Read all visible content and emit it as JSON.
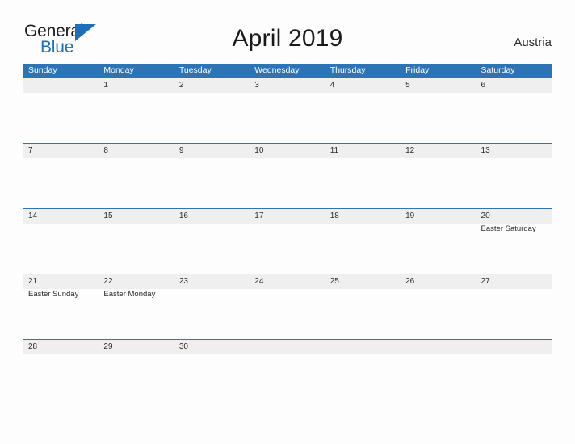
{
  "logo": {
    "word_top": "General",
    "word_bottom": "Blue",
    "triangle_icon": "triangle-flag-icon",
    "accent_color": "#1f6fb8"
  },
  "header": {
    "title": "April 2019",
    "region": "Austria"
  },
  "theme": {
    "header_blue": "#2e74b5",
    "row_band_gray": "#efefef",
    "page_background": "#fdfdfd",
    "text_color": "#2b2b2b"
  },
  "calendar": {
    "month": "April",
    "year": "2019",
    "weekday_headers": [
      "Sunday",
      "Monday",
      "Tuesday",
      "Wednesday",
      "Thursday",
      "Friday",
      "Saturday"
    ],
    "weeks": [
      [
        {
          "day": "",
          "event": ""
        },
        {
          "day": "1",
          "event": ""
        },
        {
          "day": "2",
          "event": ""
        },
        {
          "day": "3",
          "event": ""
        },
        {
          "day": "4",
          "event": ""
        },
        {
          "day": "5",
          "event": ""
        },
        {
          "day": "6",
          "event": ""
        }
      ],
      [
        {
          "day": "7",
          "event": ""
        },
        {
          "day": "8",
          "event": ""
        },
        {
          "day": "9",
          "event": ""
        },
        {
          "day": "10",
          "event": ""
        },
        {
          "day": "11",
          "event": ""
        },
        {
          "day": "12",
          "event": ""
        },
        {
          "day": "13",
          "event": ""
        }
      ],
      [
        {
          "day": "14",
          "event": ""
        },
        {
          "day": "15",
          "event": ""
        },
        {
          "day": "16",
          "event": ""
        },
        {
          "day": "17",
          "event": ""
        },
        {
          "day": "18",
          "event": ""
        },
        {
          "day": "19",
          "event": ""
        },
        {
          "day": "20",
          "event": "Easter Saturday"
        }
      ],
      [
        {
          "day": "21",
          "event": "Easter Sunday"
        },
        {
          "day": "22",
          "event": "Easter Monday"
        },
        {
          "day": "23",
          "event": ""
        },
        {
          "day": "24",
          "event": ""
        },
        {
          "day": "25",
          "event": ""
        },
        {
          "day": "26",
          "event": ""
        },
        {
          "day": "27",
          "event": ""
        }
      ],
      [
        {
          "day": "28",
          "event": ""
        },
        {
          "day": "29",
          "event": ""
        },
        {
          "day": "30",
          "event": ""
        },
        {
          "day": "",
          "event": ""
        },
        {
          "day": "",
          "event": ""
        },
        {
          "day": "",
          "event": ""
        },
        {
          "day": "",
          "event": ""
        }
      ]
    ]
  }
}
